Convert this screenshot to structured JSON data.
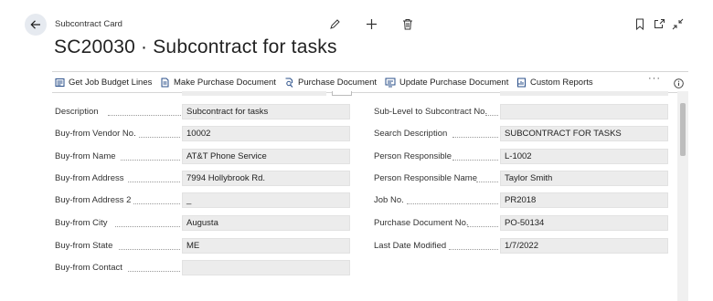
{
  "header": {
    "breadcrumb": "Subcontract Card",
    "title": "SC20030 · Subcontract for tasks",
    "icons": [
      "edit-icon",
      "add-icon",
      "delete-icon",
      "bookmark-icon",
      "open-new-window-icon",
      "collapse-icon"
    ]
  },
  "actions": [
    {
      "label": "Get Job Budget Lines",
      "icon": "lines-icon"
    },
    {
      "label": "Make Purchase Document",
      "icon": "document-icon"
    },
    {
      "label": "Purchase Document",
      "icon": "search-document-icon"
    },
    {
      "label": "Update Purchase Document",
      "icon": "update-document-icon"
    },
    {
      "label": "Custom Reports",
      "icon": "report-icon"
    }
  ],
  "more_label": "···",
  "left_fields": [
    {
      "label": "Description",
      "value": "Subcontract for tasks"
    },
    {
      "label": "Buy-from Vendor No.",
      "value": "10002"
    },
    {
      "label": "Buy-from Name",
      "value": "AT&T Phone Service"
    },
    {
      "label": "Buy-from Address",
      "value": "7994 Hollybrook Rd."
    },
    {
      "label": "Buy-from Address 2",
      "value": "_"
    },
    {
      "label": "Buy-from City",
      "value": "Augusta"
    },
    {
      "label": "Buy-from State",
      "value": "ME"
    },
    {
      "label": "Buy-from Contact",
      "value": ""
    }
  ],
  "right_fields": [
    {
      "label": "Sub-Level to Subcontract No.",
      "value": ""
    },
    {
      "label": "Search Description",
      "value": "SUBCONTRACT FOR TASKS"
    },
    {
      "label": "Person Responsible",
      "value": "L-1002"
    },
    {
      "label": "Person Responsible Name",
      "value": "Taylor Smith"
    },
    {
      "label": "Job No.",
      "value": "PR2018"
    },
    {
      "label": "Purchase Document No.",
      "value": "PO-50134"
    },
    {
      "label": "Last Date Modified",
      "value": "1/7/2022"
    }
  ],
  "colors": {
    "accent": "#0f6cbd",
    "field_bg": "#ececec",
    "back_button_bg": "#e6eaf0"
  }
}
